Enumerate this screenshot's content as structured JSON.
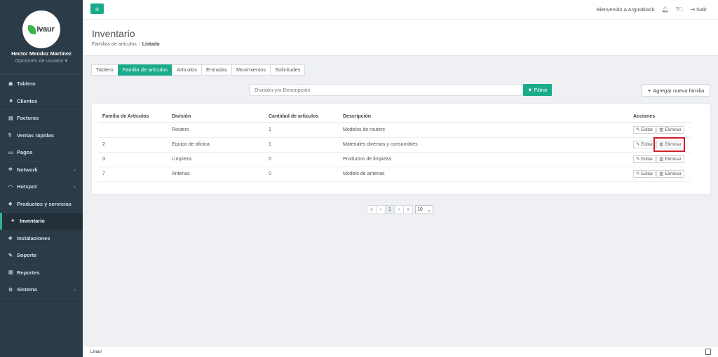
{
  "sidebar": {
    "brand": "ivaur",
    "user_name": "Hector Mendez Martinez",
    "user_options": "Opciones de usuario ▾",
    "items": [
      {
        "label": "Tablero",
        "icon": "dashboard-icon",
        "glyph": "☗",
        "chevron": false
      },
      {
        "label": "Clientes",
        "icon": "users-icon",
        "glyph": "☻",
        "chevron": false
      },
      {
        "label": "Facturas",
        "icon": "file-icon",
        "glyph": "▤",
        "chevron": false
      },
      {
        "label": "Ventas rápidas",
        "icon": "dollar-icon",
        "glyph": "$",
        "chevron": false
      },
      {
        "label": "Pagos",
        "icon": "money-icon",
        "glyph": "▭",
        "chevron": false
      },
      {
        "label": "Network",
        "icon": "network-icon",
        "glyph": "✲",
        "chevron": true
      },
      {
        "label": "Hotspot",
        "icon": "wifi-icon",
        "glyph": "◠",
        "chevron": true
      },
      {
        "label": "Productos y servicios",
        "icon": "tag-icon",
        "glyph": "◆",
        "chevron": false
      },
      {
        "label": "Inventario",
        "icon": "cubes-icon",
        "glyph": "♣",
        "chevron": false,
        "active": true
      },
      {
        "label": "Instalaciones",
        "icon": "tools-icon",
        "glyph": "◈",
        "chevron": false
      },
      {
        "label": "Soporte",
        "icon": "wrench-icon",
        "glyph": "✎",
        "chevron": false
      },
      {
        "label": "Reportes",
        "icon": "book-icon",
        "glyph": "▥",
        "chevron": false
      },
      {
        "label": "Sistema",
        "icon": "cogs-icon",
        "glyph": "⚙",
        "chevron": true
      }
    ]
  },
  "topbar": {
    "welcome": "Bienvenido a ArgusBlack",
    "logout": "Salir"
  },
  "header": {
    "title": "Inventario",
    "breadcrumb_parent": "Familias de articulos",
    "breadcrumb_current": "Listado"
  },
  "tabs": [
    "Tablero",
    "Familia de articulos",
    "Articulos",
    "Entradas",
    "Movimientos",
    "Solicitudes"
  ],
  "filter": {
    "placeholder": "División y/o Descripción",
    "button": "Filtrar",
    "add_button": "Agregar nueva familia"
  },
  "table": {
    "headers": [
      "Familia de Articulos",
      "División",
      "Cantidad de articulos",
      "Descripción",
      "Acciones"
    ],
    "edit_label": "Editar",
    "delete_label": "Eliminar",
    "rows": [
      {
        "familia": "",
        "division": "Routers",
        "cantidad": "1",
        "descripcion": "Modelos de routers"
      },
      {
        "familia": "2",
        "division": "Equipo de oficina",
        "cantidad": "1",
        "descripcion": "Materiales diversos y consumibles"
      },
      {
        "familia": "3",
        "division": "Limpieza",
        "cantidad": "0",
        "descripcion": "Productos de limpieza"
      },
      {
        "familia": "7",
        "division": "Antenas",
        "cantidad": "0",
        "descripcion": "Modelo de antenas"
      }
    ]
  },
  "pagination": {
    "first": "«",
    "prev": "‹",
    "current": "1",
    "next": "›",
    "last": "»",
    "page_size": "10"
  },
  "footer": {
    "text": "Livaur"
  }
}
